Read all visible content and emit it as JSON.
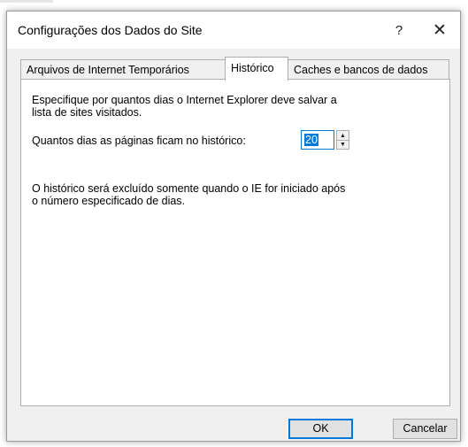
{
  "dialog": {
    "title": "Configurações dos Dados do Site",
    "help_label": "?",
    "close_label": "✕"
  },
  "tabs": [
    {
      "label": "Arquivos de Internet Temporários",
      "active": false
    },
    {
      "label": "Histórico",
      "active": true
    },
    {
      "label": "Caches e bancos de dados",
      "active": false
    }
  ],
  "history": {
    "description": "Especifique por quantos dias o Internet Explorer deve salvar a\nlista de sites visitados.",
    "days_label": "Quantos dias as páginas ficam no histórico:",
    "days_value": "20",
    "note": "O histórico será excluído somente quando o IE for iniciado após\no número especificado de dias."
  },
  "buttons": {
    "ok": "OK",
    "cancel": "Cancelar"
  },
  "colors": {
    "accent": "#0078d7",
    "dialog_bg": "#f0f0f0",
    "panel_bg": "#ffffff"
  },
  "icons": {
    "spin_up": "triangle-up-icon",
    "spin_down": "triangle-down-icon"
  }
}
